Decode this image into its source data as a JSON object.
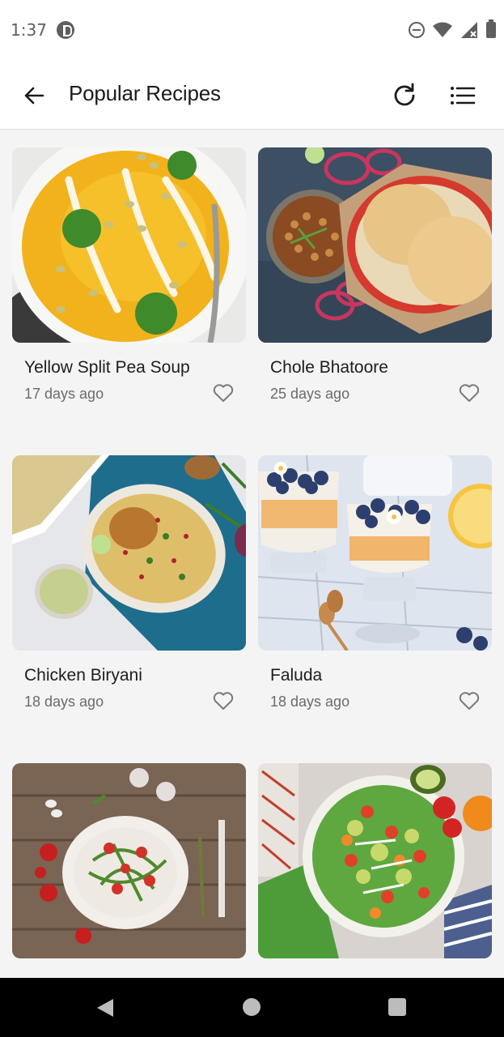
{
  "status_bar": {
    "time": "1:37",
    "icons": [
      "app-notification-icon",
      "do-not-disturb-icon",
      "wifi-icon",
      "signal-icon",
      "battery-icon"
    ]
  },
  "app_bar": {
    "title": "Popular Recipes",
    "icons": [
      "back-arrow-icon",
      "refresh-icon",
      "list-icon"
    ]
  },
  "recipes": [
    {
      "title": "Yellow Split Pea Soup",
      "subtitle": "17 days ago",
      "image": "yellow split pea soup with cilantro and seeds",
      "favorited": false
    },
    {
      "title": "Chole Bhatoore",
      "subtitle": "25 days ago",
      "image": "chickpea curry with fried bread and onion rings",
      "favorited": false
    },
    {
      "title": "Chicken Biryani",
      "subtitle": "18 days ago",
      "image": "chicken biryani rice platter with green chutney",
      "favorited": false
    },
    {
      "title": "Faluda",
      "subtitle": "18 days ago",
      "image": "layered dessert glasses topped with blueberries",
      "favorited": false
    },
    {
      "title": "",
      "subtitle": "",
      "image": "arugula tomato salad on wooden table",
      "favorited": false
    },
    {
      "title": "",
      "subtitle": "",
      "image": "colorful avocado salad bowl",
      "favorited": false
    }
  ],
  "nav_bar": {
    "icons": [
      "nav-back-icon",
      "nav-home-icon",
      "nav-recents-icon"
    ]
  },
  "colors": {
    "background": "#f4f4f4",
    "app_bar": "#ffffff",
    "title_text": "#1d1d1d",
    "subtitle_text": "#6b6b6b",
    "icon": "#1b1b1b",
    "nav_bar": "#000000"
  }
}
